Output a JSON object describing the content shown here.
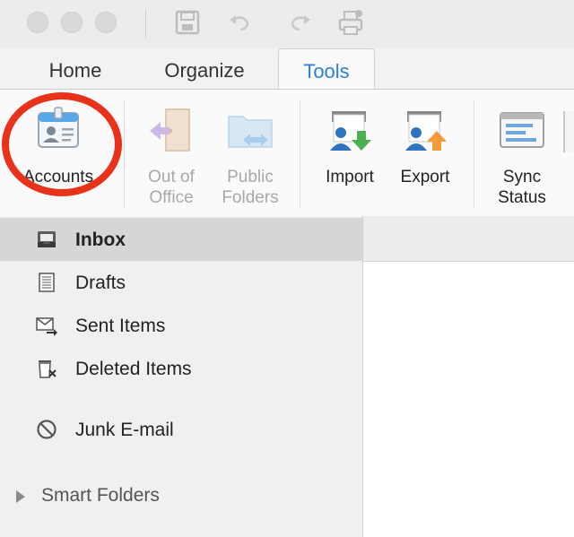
{
  "window": {
    "traffic_lights": [
      "close",
      "minimize",
      "zoom"
    ],
    "toolbar_icons": [
      "save-icon",
      "undo-icon",
      "redo-icon",
      "print-icon"
    ]
  },
  "tabs": [
    {
      "label": "Home",
      "active": false
    },
    {
      "label": "Organize",
      "active": false
    },
    {
      "label": "Tools",
      "active": true
    }
  ],
  "ribbon": {
    "buttons": [
      {
        "id": "accounts",
        "label": "Accounts",
        "enabled": true,
        "icon": "accounts-card-icon"
      },
      {
        "id": "out_of_office",
        "label": "Out of\nOffice",
        "enabled": false,
        "icon": "door-arrow-icon"
      },
      {
        "id": "public_folders",
        "label": "Public\nFolders",
        "enabled": false,
        "icon": "folder-arrows-icon"
      },
      {
        "id": "import",
        "label": "Import",
        "enabled": true,
        "icon": "import-icon"
      },
      {
        "id": "export",
        "label": "Export",
        "enabled": true,
        "icon": "export-icon"
      },
      {
        "id": "sync_status",
        "label": "Sync\nStatus",
        "enabled": true,
        "icon": "sync-status-icon"
      }
    ],
    "highlight_color": "#e8321a"
  },
  "folders": [
    {
      "label": "Inbox",
      "icon": "inbox-icon",
      "selected": true
    },
    {
      "label": "Drafts",
      "icon": "drafts-icon",
      "selected": false
    },
    {
      "label": "Sent Items",
      "icon": "sent-items-icon",
      "selected": false
    },
    {
      "label": "Deleted Items",
      "icon": "deleted-items-icon",
      "selected": false
    },
    {
      "label": "Junk E-mail",
      "icon": "junk-icon",
      "selected": false
    }
  ],
  "smart_folders": {
    "label": "Smart Folders"
  },
  "colors": {
    "accent": "#2a7fd8",
    "disabled_text": "#a8a8a8"
  }
}
